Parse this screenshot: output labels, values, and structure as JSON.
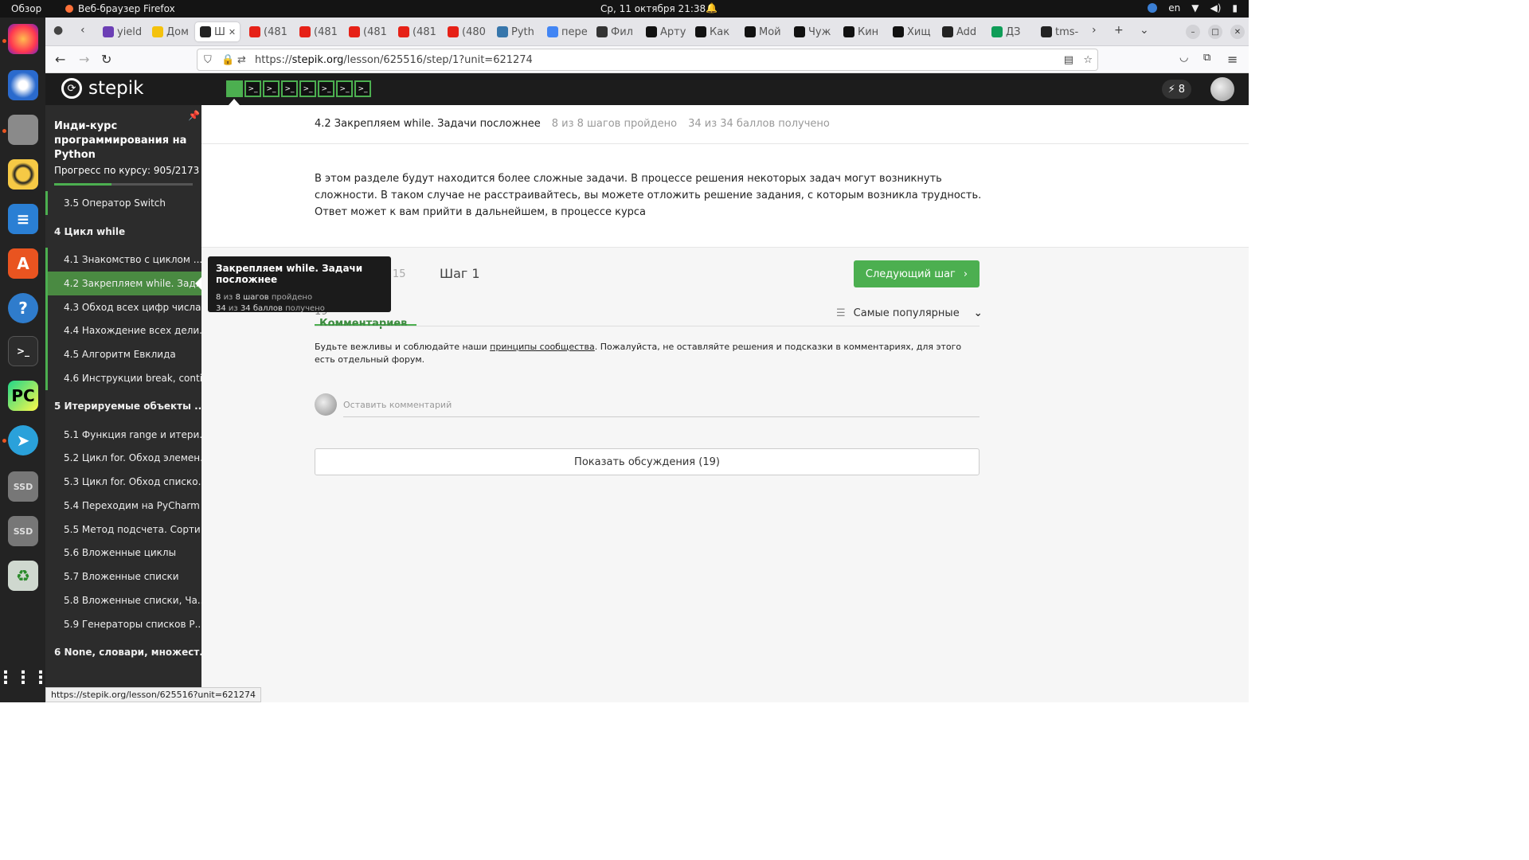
{
  "os": {
    "overview": "Обзор",
    "app_name": "Веб-браузер Firefox",
    "clock": "Ср, 11 октября  21:38",
    "lang": "en"
  },
  "tabs": [
    {
      "label": "yield",
      "icon": "yahoo-icon",
      "color": "#6c3fb5"
    },
    {
      "label": "Дом",
      "icon": "note-icon",
      "color": "#f4c20d"
    },
    {
      "label": "Ш",
      "icon": "stepik-icon",
      "color": "#222222",
      "active": true
    },
    {
      "label": "(481",
      "icon": "youtube-icon",
      "color": "#e62117"
    },
    {
      "label": "(481",
      "icon": "youtube-icon",
      "color": "#e62117"
    },
    {
      "label": "(481",
      "icon": "youtube-icon",
      "color": "#e62117"
    },
    {
      "label": "(481",
      "icon": "youtube-icon",
      "color": "#e62117"
    },
    {
      "label": "(480",
      "icon": "youtube-icon",
      "color": "#e62117"
    },
    {
      "label": "Pyth",
      "icon": "python-icon",
      "color": "#3776ab"
    },
    {
      "label": "пере",
      "icon": "google-icon",
      "color": "#4285f4"
    },
    {
      "label": "Фил",
      "icon": "cinema-icon",
      "color": "#333333"
    },
    {
      "label": "Арту",
      "icon": "bookmark-icon",
      "color": "#111111"
    },
    {
      "label": "Как",
      "icon": "bookmark-icon",
      "color": "#111111"
    },
    {
      "label": "Мой",
      "icon": "bookmark-icon",
      "color": "#111111"
    },
    {
      "label": "Чуж",
      "icon": "bookmark-icon",
      "color": "#111111"
    },
    {
      "label": "Кин",
      "icon": "bookmark-icon",
      "color": "#111111"
    },
    {
      "label": "Хищ",
      "icon": "bookmark-icon",
      "color": "#111111"
    },
    {
      "label": "Add",
      "icon": "github-icon",
      "color": "#222222"
    },
    {
      "label": "ДЗ",
      "icon": "sheets-icon",
      "color": "#0f9d58"
    },
    {
      "label": "tms-",
      "icon": "github-icon",
      "color": "#222222"
    }
  ],
  "url": {
    "prefix": "https://",
    "host": "stepik.org",
    "path": "/lesson/625516/step/1?unit=621274"
  },
  "header": {
    "logo_text": "stepik",
    "energy": "8",
    "steps": [
      "",
      ">_",
      ">_",
      ">_",
      ">_",
      ">_",
      ">_",
      ">_"
    ]
  },
  "sidebar": {
    "course_title": "Инди-курс программирования на Python",
    "progress_label": "Прогресс по курсу:  905/2173",
    "progress_fraction": 0.4165,
    "items": [
      {
        "label": "3.5  Оператор Switch",
        "type": "lesson",
        "done": true
      },
      {
        "label": "4  Цикл while",
        "type": "section"
      },
      {
        "label": "4.1  Знакомство с циклом ...",
        "type": "lesson",
        "done": true
      },
      {
        "label": "4.2  Закрепляем while. Зад...",
        "type": "lesson",
        "done": true,
        "active": true
      },
      {
        "label": "4.3  Обход всех цифр числа...",
        "type": "lesson",
        "done": true
      },
      {
        "label": "4.4  Нахождение всех дели...",
        "type": "lesson",
        "done": true
      },
      {
        "label": "4.5  Алгоритм Евклида",
        "type": "lesson",
        "done": true
      },
      {
        "label": "4.6  Инструкции break, conti...",
        "type": "lesson",
        "done": true
      },
      {
        "label": "5  Итерируемые объекты ...",
        "type": "section"
      },
      {
        "label": "5.1  Функция range и итери...",
        "type": "lesson",
        "done": false
      },
      {
        "label": "5.2  Цикл for. Обход элемен...",
        "type": "lesson",
        "done": false
      },
      {
        "label": "5.3  Цикл for. Обход списко...",
        "type": "lesson",
        "done": false
      },
      {
        "label": "5.4  Переходим на PyCharm",
        "type": "lesson",
        "done": false
      },
      {
        "label": "5.5  Метод подсчета. Сорти...",
        "type": "lesson",
        "done": false
      },
      {
        "label": "5.6  Вложенные циклы",
        "type": "lesson",
        "done": false
      },
      {
        "label": "5.7  Вложенные списки",
        "type": "lesson",
        "done": false
      },
      {
        "label": "5.8  Вложенные списки, Ча...",
        "type": "lesson",
        "done": false
      },
      {
        "label": "5.9  Генераторы списков Р...",
        "type": "lesson",
        "done": false
      },
      {
        "label": "6  None, словари, множест...",
        "type": "section"
      }
    ]
  },
  "lesson": {
    "title": "4.2 Закрепляем while. Задачи посложнее",
    "steps_done": "8 из 8 шагов пройдено",
    "points": "34 из 34 баллов  получено",
    "text": "В этом разделе будут находится более сложные задачи. В процессе решения некоторых задач могут возникнуть сложности. В таком случае не расстраивайтесь, вы можете отложить решение задания, с которым возникла трудность. Ответ может к вам прийти в дальнейшем, в процессе курса",
    "step_label": "Шаг 1",
    "partial_num": "15",
    "next_button": "Следующий шаг",
    "comments_count": "19",
    "comments_label": "Комментариев",
    "sort_label": "Самые популярные",
    "rules_before": "Будьте вежливы и соблюдайте наши ",
    "rules_link": "принципы сообщества",
    "rules_after": ". Пожалуйста, не оставляйте решения и подсказки в комментариях, для этого есть отдельный форум.",
    "comment_placeholder": "Оставить комментарий",
    "show_discussions": "Показать обсуждения (19)"
  },
  "tooltip": {
    "title": "Закрепляем while. Задачи посложнее",
    "steps_a": "8",
    "steps_b": "из",
    "steps_c": "8 шагов",
    "steps_d": "пройдено",
    "points_a": "34",
    "points_b": "из",
    "points_c": "34 баллов",
    "points_d": "получено"
  },
  "status_url": "https://stepik.org/lesson/625516?unit=621274"
}
